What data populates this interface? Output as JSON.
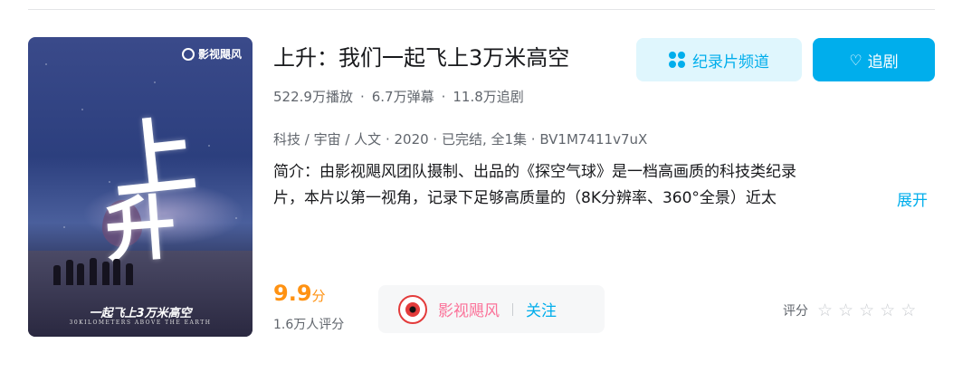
{
  "poster": {
    "logo_text": "影视飓风",
    "big_chars": [
      "上",
      "升"
    ],
    "tagline": "一起飞上3万米高空",
    "tagline_en": "30KILOMETERS ABOVE THE EARTH"
  },
  "title": "上升：我们一起飞上3万米高空",
  "stats": {
    "plays": "522.9万播放",
    "danmaku": "6.7万弹幕",
    "follows": "11.8万追剧",
    "separator": "·"
  },
  "meta": "科技 / 宇宙 / 人文 · 2020 · 已完结, 全1集 · BV1M7411v7uX",
  "description": {
    "line1": "简介：由影视飓风团队摄制、出品的《探空气球》是一档高画质的科技类纪录",
    "line2": "片，本片以第一视角，记录下足够高质量的（8K分辨率、360°全景）近太",
    "expand_label": "展开"
  },
  "buttons": {
    "channel_label": "纪录片频道",
    "follow_label": "追剧"
  },
  "score": {
    "value": "9.9",
    "unit": "分",
    "count": "1.6万人评分"
  },
  "uploader": {
    "name": "影视飓风",
    "divider": "|",
    "follow_label": "关注"
  },
  "rating": {
    "label": "评分",
    "stars": [
      "☆",
      "☆",
      "☆",
      "☆",
      "☆"
    ]
  },
  "colors": {
    "accent": "#00aeec",
    "score": "#ff9212",
    "uploader_name": "#fb7299"
  }
}
